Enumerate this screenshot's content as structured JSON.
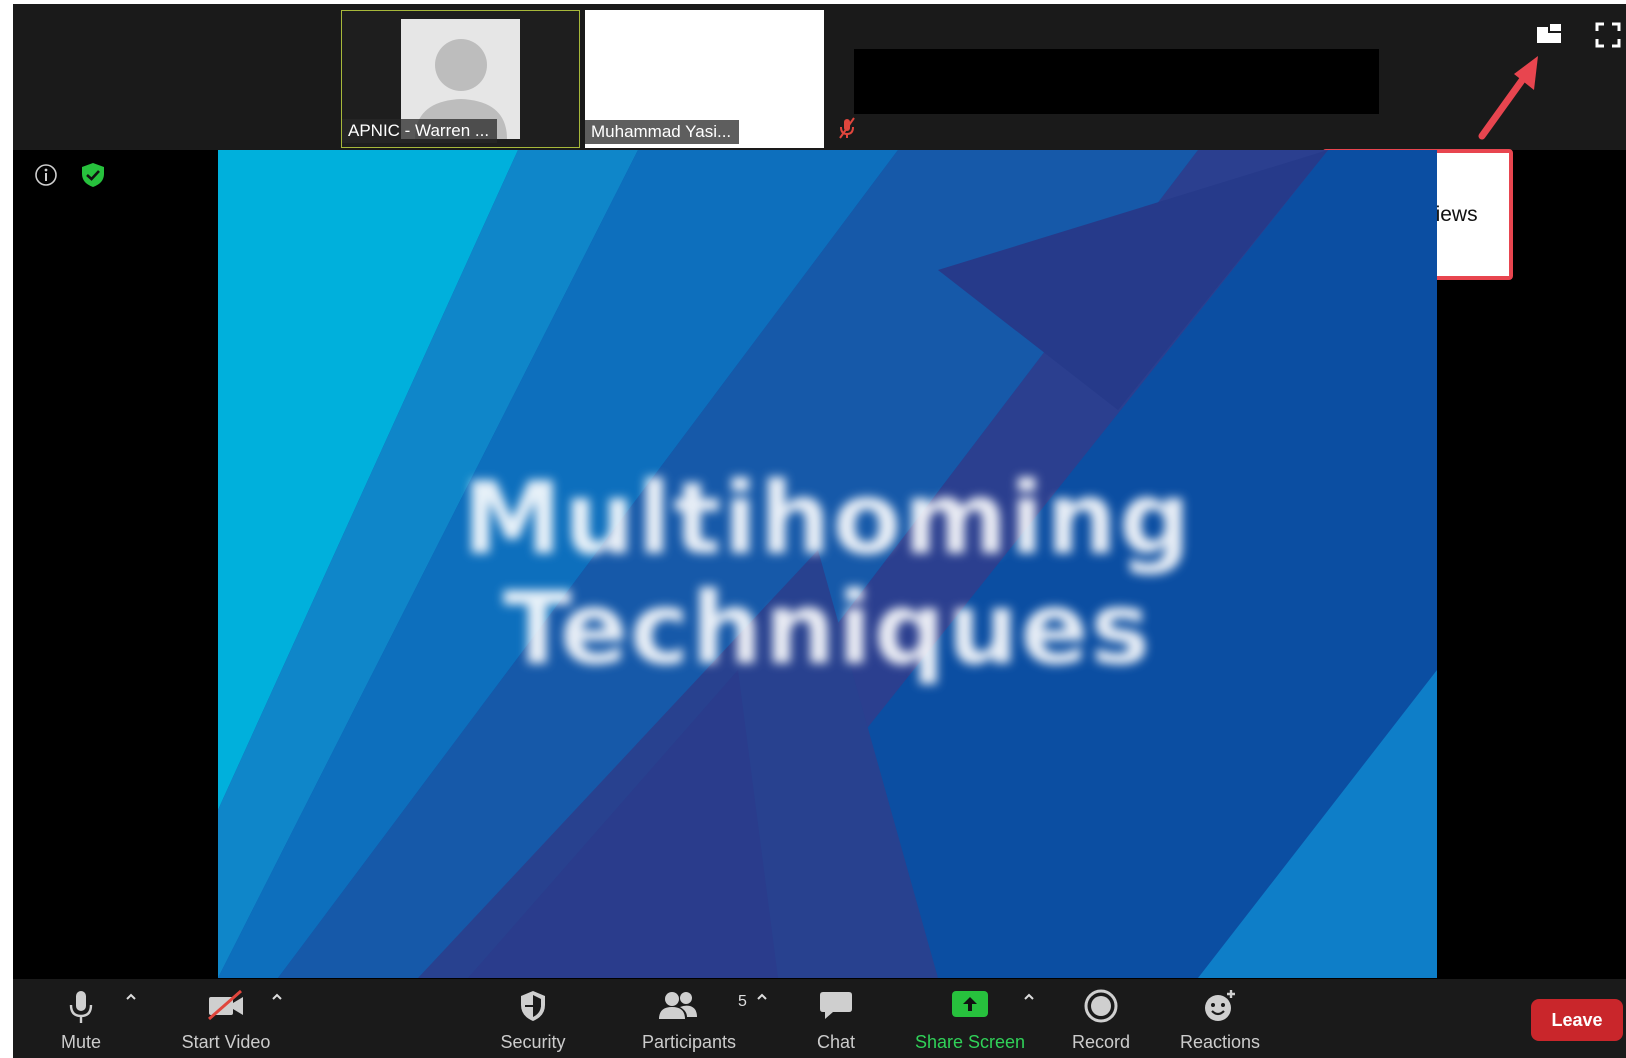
{
  "participants": {
    "tiles": [
      {
        "name": "APNIC - Warren ..."
      },
      {
        "name": "Muhammad Yasi..."
      }
    ]
  },
  "overlay": {
    "tooltip_text": "Switch views"
  },
  "slide": {
    "line1": "Multihoming",
    "line2": "Techniques"
  },
  "toolbar": {
    "mute_label": "Mute",
    "start_video_label": "Start Video",
    "security_label": "Security",
    "participants_label": "Participants",
    "participants_count": "5",
    "chat_label": "Chat",
    "share_screen_label": "Share Screen",
    "record_label": "Record",
    "reactions_label": "Reactions",
    "leave_label": "Leave"
  },
  "icons": {
    "switch_views": "switch-views-icon",
    "fullscreen": "fullscreen-icon",
    "info": "info-icon",
    "security_shield": "shield-check-icon",
    "mic": "microphone-icon",
    "video_off": "video-off-icon",
    "security": "shield-icon",
    "participants": "people-icon",
    "chat": "chat-bubble-icon",
    "share": "share-screen-icon",
    "record": "record-icon",
    "reactions": "smiley-plus-icon"
  },
  "colors": {
    "share_screen_green": "#30d158",
    "leave_red": "#c9262b",
    "annotation_red": "#e8454f",
    "active_speaker_border": "#a7b83a"
  }
}
